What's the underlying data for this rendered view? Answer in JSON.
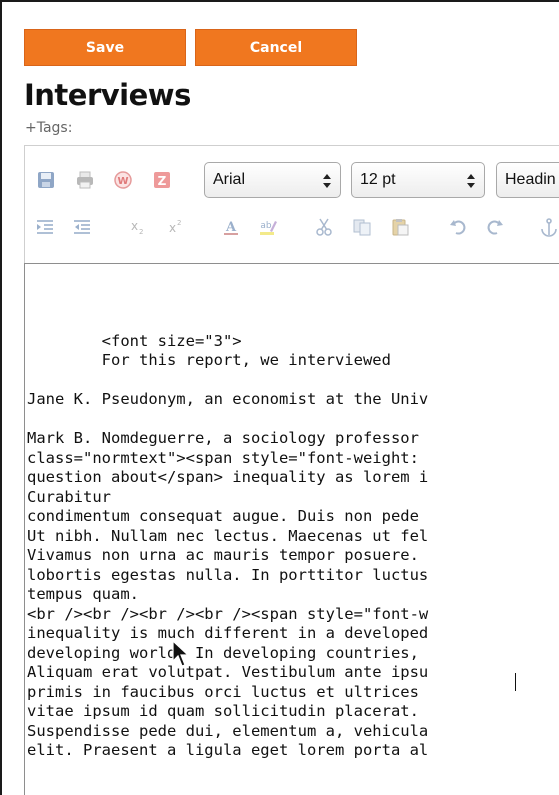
{
  "actions": {
    "save_label": "Save",
    "cancel_label": "Cancel"
  },
  "page": {
    "title": "Interviews",
    "tags_label": "+Tags:"
  },
  "toolbar": {
    "font_family": "Arial",
    "font_size": "12 pt",
    "block_format": "Headin",
    "row1_icons": [
      "save-icon",
      "print-icon",
      "word-icon",
      "zoho-icon"
    ],
    "row2_icons": [
      "indent-icon",
      "outdent-icon",
      "subscript-icon",
      "superscript-icon",
      "font-color-icon",
      "highlight-color-icon",
      "cut-icon",
      "copy-icon",
      "paste-icon",
      "undo-icon",
      "redo-icon",
      "anchor-icon"
    ]
  },
  "editor": {
    "lines": [
      "",
      "        <font size=\"3\">",
      "        For this report, we interviewed",
      "",
      "Jane K. Pseudonym, an economist at the Univ",
      "",
      "Mark B. Nomdeguerre, a sociology professor",
      "class=\"normtext\"><span style=\"font-weight:",
      "question about</span> inequality as lorem i",
      "Curabitur",
      "condimentum consequat augue. Duis non pede",
      "Ut nibh. Nullam nec lectus. Maecenas ut fel",
      "Vivamus non urna ac mauris tempor posuere.",
      "lobortis egestas nulla. In porttitor luctus",
      "tempus quam.",
      "<br /><br /><br /><br /><span style=\"font-w",
      "inequality is much different in a developed",
      "developing world. In developing countries,",
      "Aliquam erat volutpat. Vestibulum ante ipsu",
      "primis in faucibus orci luctus et ultrices",
      "vitae ipsum id quam sollicitudin placerat.",
      "Suspendisse pede dui, elementum a, vehicula",
      "elit. Praesent a ligula eget lorem porta al"
    ]
  }
}
